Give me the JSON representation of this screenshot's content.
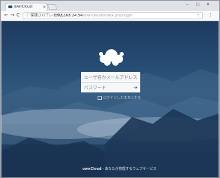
{
  "browser": {
    "tab_title": "ownCloud",
    "tab_close": "×",
    "controls": {
      "minimize": "–",
      "maximize": "□",
      "close": "✕"
    },
    "nav": {
      "back": "←",
      "forward": "→",
      "reload": "C"
    },
    "address": {
      "info_icon": "ⓘ",
      "security_text": "保護されていません",
      "url_host": "192.168.24.54",
      "url_path": "/owncloud/index.php/login",
      "star": "☆"
    },
    "menu_icon": "⋮"
  },
  "login": {
    "username_placeholder": "ユーザ名かメールアドレス",
    "password_placeholder": "パスワード",
    "submit_icon": "➔",
    "remember_label": "ログインしたままにする"
  },
  "footer": {
    "brand": "ownCloud",
    "tagline": " - あなたが管理するウェブサービス"
  },
  "colors": {
    "background_top": "#1e3a5f",
    "background_bottom": "#1a3455",
    "accent": "#ffffff"
  }
}
